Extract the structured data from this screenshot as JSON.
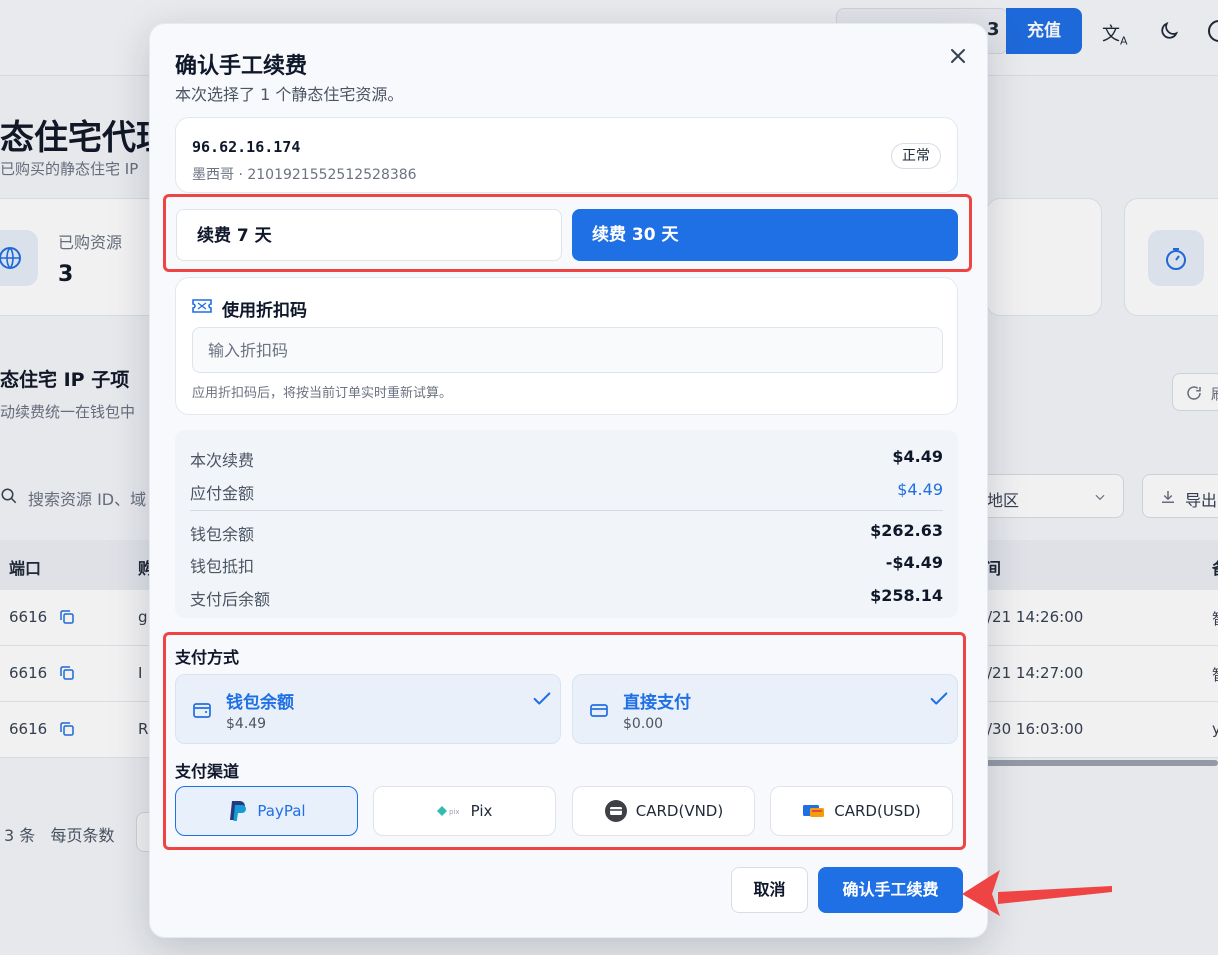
{
  "background": {
    "topbar": {
      "box_text": "3",
      "recharge_label": "充值",
      "lang_icon": "translate-icon",
      "theme_icon": "moon-icon"
    },
    "page_title": "态住宅代理",
    "page_subtitle": "已购买的静态住宅 IP",
    "stat_card": {
      "label": "已购资源",
      "value": "3",
      "icon": "globe-icon"
    },
    "stat_card_right_icon": "timer-icon",
    "section_title": "态住宅 IP 子项",
    "section_subtitle": "动续费统一在钱包中",
    "refresh_label": "刷",
    "search_placeholder": "搜索资源 ID、域",
    "region_label": "地区",
    "export_label": "导出",
    "table": {
      "headers": [
        "端口",
        "购",
        "间",
        "备"
      ],
      "rows": [
        {
          "port": "6616",
          "col2": "g",
          "time": "/21 14:26:00",
          "last": "智"
        },
        {
          "port": "6616",
          "col2": "I",
          "time": "/21 14:27:00",
          "last": "智"
        },
        {
          "port": "6616",
          "col2": "R",
          "time": "/30 16:03:00",
          "last": "y"
        }
      ]
    },
    "footer": {
      "total": "3 条",
      "page_size_label": "每页条数"
    }
  },
  "modal": {
    "title": "确认手工续费",
    "subtitle": "本次选择了 1 个静态住宅资源。",
    "resource": {
      "ip": "96.62.16.174",
      "meta": "墨西哥 · 2101921552512528386",
      "status": "正常"
    },
    "renew_options": [
      {
        "label": "续费 7 天",
        "selected": false
      },
      {
        "label": "续费 30 天",
        "selected": true
      }
    ],
    "discount": {
      "label": "使用折扣码",
      "placeholder": "输入折扣码",
      "hint": "应用折扣码后，将按当前订单实时重新试算。"
    },
    "summary": {
      "renew_fee_label": "本次续费",
      "renew_fee": "$4.49",
      "payable_label": "应付金额",
      "payable": "$4.49",
      "wallet_balance_label": "钱包余额",
      "wallet_balance": "$262.63",
      "wallet_deduct_label": "钱包抵扣",
      "wallet_deduct": "-$4.49",
      "after_balance_label": "支付后余额",
      "after_balance": "$258.14"
    },
    "payment_method": {
      "title": "支付方式",
      "options": [
        {
          "label": "钱包余额",
          "amount": "$4.49",
          "icon": "wallet-icon",
          "checked": true
        },
        {
          "label": "直接支付",
          "amount": "$0.00",
          "icon": "card-icon",
          "checked": true
        }
      ]
    },
    "payment_channel": {
      "title": "支付渠道",
      "options": [
        {
          "label": "PayPal",
          "icon": "paypal-icon",
          "selected": true
        },
        {
          "label": "Pix",
          "icon": "pix-icon",
          "selected": false
        },
        {
          "label": "CARD(VND)",
          "icon": "card-vnd-icon",
          "selected": false
        },
        {
          "label": "CARD(USD)",
          "icon": "card-usd-icon",
          "selected": false
        }
      ]
    },
    "cancel_label": "取消",
    "confirm_label": "确认手工续费"
  },
  "colors": {
    "primary": "#1f6fe5",
    "annotation_red": "#ef4444",
    "text": "#0f172a",
    "muted": "#6b7280"
  }
}
